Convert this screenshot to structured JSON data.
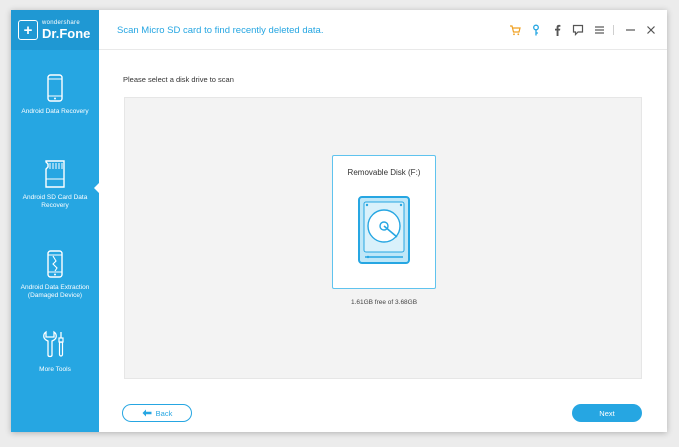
{
  "app": {
    "brand": "wondershare",
    "name": "Dr.Fone"
  },
  "header": {
    "title": "Scan Micro SD card to find recently deleted data."
  },
  "header_icons": [
    "cart-icon",
    "key-icon",
    "facebook-icon",
    "feedback-icon",
    "menu-icon",
    "minimize-icon",
    "close-icon"
  ],
  "sidebar": {
    "items": [
      {
        "label": "Android Data Recovery",
        "icon": "phone-icon"
      },
      {
        "label": "Android SD Card Data Recovery",
        "icon": "sd-card-icon",
        "active": true
      },
      {
        "label": "Android Data Extraction (Damaged Device)",
        "icon": "broken-phone-icon"
      },
      {
        "label": "More Tools",
        "icon": "tools-icon"
      }
    ]
  },
  "main": {
    "prompt": "Please select a disk drive to scan",
    "disk": {
      "name": "Removable Disk (F:)",
      "space": "1.61GB free of 3.68GB",
      "icon": "hard-drive-icon"
    },
    "back_label": "Back",
    "next_label": "Next"
  },
  "colors": {
    "accent": "#26a6e2",
    "sidebar": "#26a6e2",
    "cart": "#f0a020"
  }
}
